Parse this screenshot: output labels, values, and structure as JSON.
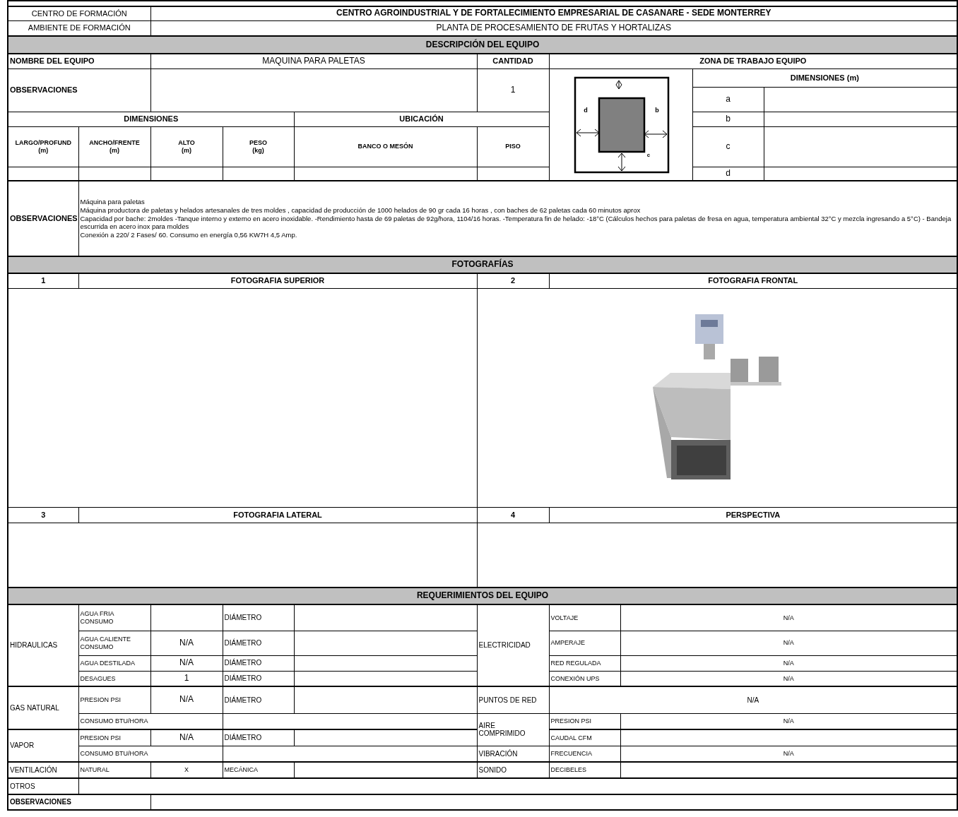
{
  "header": {
    "centro_label": "CENTRO DE FORMACIÓN",
    "centro_value": "CENTRO AGROINDUSTRIAL Y DE FORTALECIMIENTO EMPRESARIAL DE CASANARE - SEDE MONTERREY",
    "ambiente_label": "AMBIENTE DE FORMACIÓN",
    "ambiente_value": "PLANTA DE PROCESAMIENTO DE FRUTAS Y HORTALIZAS"
  },
  "description": {
    "title": "DESCRIPCIÓN DEL EQUIPO",
    "name_label": "NOMBRE DEL EQUIPO",
    "name_value": "MAQUINA PARA PALETAS",
    "quantity_label": "CANTIDAD",
    "quantity_value": "1",
    "observations_label": "OBSERVACIONES",
    "work_zone": {
      "title": "ZONA DE TRABAJO EQUIPO",
      "diagram_labels": {
        "left": "d",
        "right": "b",
        "bottom": "c"
      },
      "dimensions_title": "DIMENSIONES (m)",
      "rows": [
        "a",
        "b",
        "c",
        "d"
      ]
    },
    "dimensions": {
      "title": "DIMENSIONES",
      "columns": [
        "LARGO/PROFUND\n(m)",
        "ANCHO/FRENTE\n(m)",
        "ALTO\n(m)",
        "PESO\n(kg)"
      ]
    },
    "location": {
      "title": "UBICACIÓN",
      "columns": [
        "BANCO O MESÓN",
        "PISO"
      ]
    }
  },
  "observations": {
    "label": "OBSERVACIONES",
    "lines": [
      "Máquina para paletas",
      "Máquina productora de  paletas y helados artesanales de tres moldes , capacidad de producción de  1000 helados de 90 gr cada 16 horas  , con baches de   62 paletas cada 60 minutos aprox",
      "Capacidad por bache: 2moldes -Tanque interno y externo en acero inoxidable. -Rendimiento hasta de 69 paletas de 92g/hora, 1104/16 horas. -Temperatura fin de helado: -18°C (Cálculos hechos para paletas de fresa en agua, temperatura ambiental 32°C y mezcla ingresando a 5°C) - Bandeja escurrida en acero inox para moldes",
      "Conexión a  220/  2 Fases/ 60. Consumo en energía 0,56 KW7H 4,5 Amp."
    ]
  },
  "photos": {
    "title": "FOTOGRAFÍAS",
    "items": [
      {
        "number": "1",
        "label": "FOTOGRAFIA SUPERIOR",
        "kind": "empty"
      },
      {
        "number": "2",
        "label": "FOTOGRAFIA FRONTAL",
        "kind": "picture"
      },
      {
        "number": "3",
        "label": "FOTOGRAFIA LATERAL",
        "kind": "empty"
      },
      {
        "number": "4",
        "label": "PERSPECTIVA",
        "kind": "empty"
      }
    ]
  },
  "requirements": {
    "title": "REQUERIMIENTOS DEL EQUIPO",
    "hydraulics": {
      "category": "HIDRAULICAS",
      "rows": [
        {
          "label": "AGUA FRIA\nCONSUMO",
          "diameter_label": "DIÁMETRO"
        },
        {
          "label": "AGUA CALIENTE\nCONSUMO",
          "value": "N/A",
          "diameter_label": "DIÁMETRO"
        },
        {
          "label": "AGUA DESTILADA",
          "value": "N/A",
          "diameter_label": "DIÁMETRO"
        },
        {
          "label": "DESAGUES",
          "value": "1",
          "diameter_label": "DIÁMETRO"
        }
      ]
    },
    "gas": {
      "category": "GAS NATURAL",
      "pressure_label": "PRESION PSI",
      "pressure_value": "N/A",
      "diameter_label": "DIÁMETRO",
      "consumption_label": "CONSUMO BTU/HORA"
    },
    "vapor": {
      "category": "VAPOR",
      "pressure_label": "PRESION PSI",
      "pressure_value": "N/A",
      "diameter_label": "DIÁMETRO",
      "consumption_label": "CONSUMO BTU/HORA"
    },
    "ventilation": {
      "category": "VENTILACIÓN",
      "natural_label": "NATURAL",
      "natural_value": "X",
      "mechanical_label": "MECÁNICA"
    },
    "electricity": {
      "category": "ELECTRICIDAD",
      "rows": [
        {
          "label": "VOLTAJE",
          "value": "N/A"
        },
        {
          "label": "AMPERAJE",
          "value": "N/A"
        },
        {
          "label": "RED REGULADA",
          "value": "N/A"
        },
        {
          "label": "CONEXIÓN UPS",
          "value": "N/A"
        }
      ]
    },
    "network": {
      "category": "PUNTOS DE RED",
      "value": "N/A"
    },
    "air": {
      "category": "AIRE\nCOMPRIMIDO",
      "rows": [
        {
          "label": "PRESION PSI",
          "value": "N/A"
        },
        {
          "label": "CAUDAL CFM"
        }
      ]
    },
    "vibration": {
      "category": "VIBRACIÓN",
      "label": "FRECUENCIA",
      "value": "N/A"
    },
    "sound": {
      "category": "SONIDO",
      "label": "DECIBELES"
    },
    "others_label": "OTROS",
    "observations_label": "OBSERVACIONES"
  }
}
